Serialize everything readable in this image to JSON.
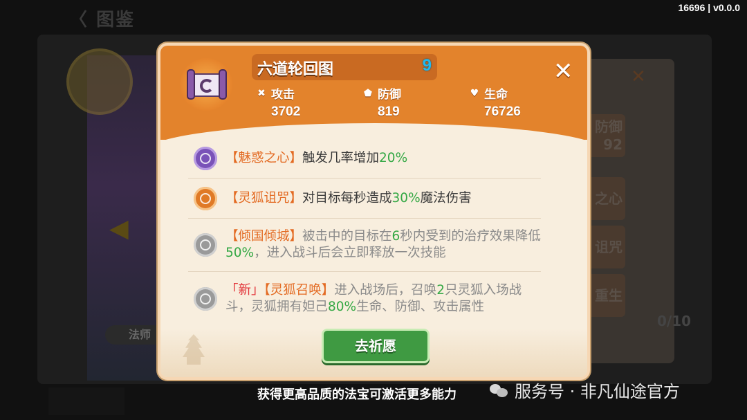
{
  "background": {
    "screen_title": "图鉴",
    "class_label": "法师",
    "right_tabs": [
      "防御\n92",
      "之心",
      "诅咒",
      "重生"
    ],
    "collection_count": "0/10"
  },
  "version": "16696 | v0.0.0",
  "dialog": {
    "title": "六道轮回图",
    "level": "9",
    "stats": [
      {
        "icon": "attack-icon",
        "label": "攻击",
        "value": "3702"
      },
      {
        "icon": "shield-icon",
        "label": "防御",
        "value": "819"
      },
      {
        "icon": "heart-icon",
        "label": "生命",
        "value": "76726"
      }
    ],
    "skills": [
      {
        "state": "active",
        "icon_color": "purple",
        "name": "【魅惑之心】",
        "parts": [
          "触发几率增加",
          "20%",
          ""
        ]
      },
      {
        "state": "active",
        "icon_color": "orange",
        "name": "【灵狐诅咒】",
        "parts": [
          "对目标每秒造成",
          "30%",
          "魔法伤害"
        ]
      },
      {
        "state": "locked",
        "icon_color": "gray",
        "name": "【倾国倾城】",
        "text": "被击中的目标在6秒内受到的治疗效果降低50%，进入战斗后会立即释放一次技能"
      },
      {
        "state": "locked",
        "icon_color": "gray",
        "new_tag": "「新」",
        "name": "【灵狐召唤】",
        "text": "进入战场后，召唤2只灵狐入场战斗，灵狐拥有妲己80%生命、防御、攻击属性"
      }
    ],
    "pray_button": "去祈愿"
  },
  "caption": "获得更高品质的法宝可激活更多能力",
  "watermark": "服务号 · 非凡仙途官方",
  "colors": {
    "header": "#e3832c",
    "panel": "#f8eede",
    "accent_orange": "#e36a22",
    "accent_green": "#35a845",
    "new_red": "#e2353a",
    "button_green": "#3f9a42"
  }
}
